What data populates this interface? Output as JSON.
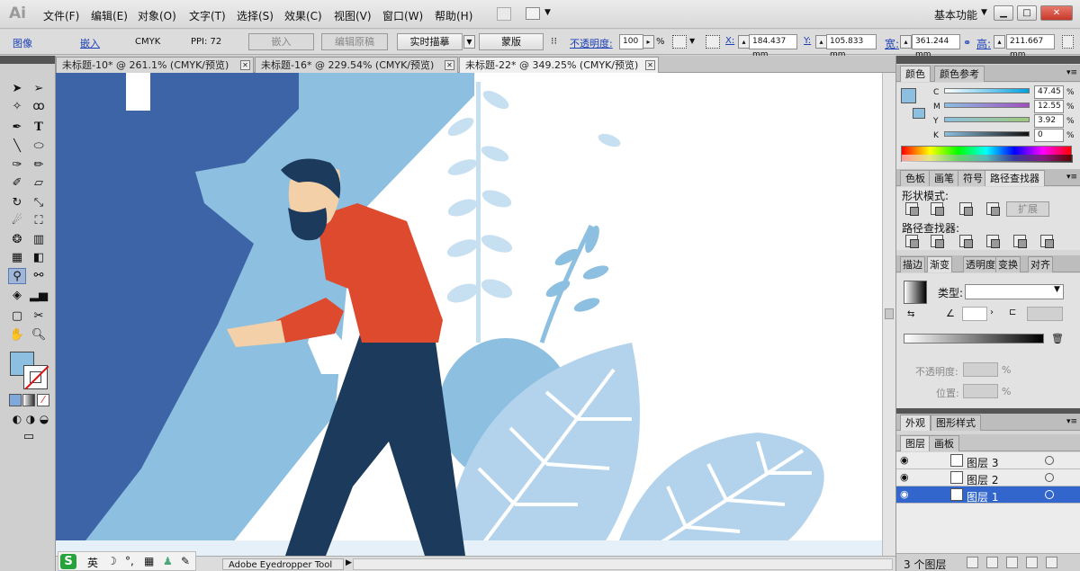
{
  "app": {
    "logo": "Ai"
  },
  "menu": [
    "文件(F)",
    "编辑(E)",
    "对象(O)",
    "文字(T)",
    "选择(S)",
    "效果(C)",
    "视图(V)",
    "窗口(W)",
    "帮助(H)"
  ],
  "workspace": {
    "label": "基本功能",
    "caret": "▼"
  },
  "window_controls": {
    "minimize": "▁",
    "restore": "□",
    "close": "✕"
  },
  "controlbar": {
    "image_label": "图像",
    "embed_link": "嵌入",
    "colormode": "CMYK",
    "ppi": "PPI: 72",
    "embed_button": "嵌入",
    "edit_original": "编辑原稿",
    "live_trace": "实时描摹",
    "mask": "蒙版",
    "opacity_label": "不透明度:",
    "opacity_value": "100",
    "pct": "%",
    "x_label": "X:",
    "x_value": "184.437 mm",
    "y_label": "Y:",
    "y_value": "105.833 mm",
    "w_label": "宽:",
    "w_value": "361.244 mm",
    "h_label": "高:",
    "h_value": "211.667 mm"
  },
  "tabs": [
    {
      "label": "未标题-10* @ 261.1% (CMYK/预览)",
      "active": false
    },
    {
      "label": "未标题-16* @ 229.54% (CMYK/预览)",
      "active": false
    },
    {
      "label": "未标题-22* @ 349.25% (CMYK/预览)",
      "active": true
    }
  ],
  "tools": [
    "selection-tool",
    "direct-selection-tool",
    "magic-wand-tool",
    "lasso-tool",
    "pen-tool",
    "type-tool",
    "line-tool",
    "ellipse-tool",
    "paintbrush-tool",
    "pencil-tool",
    "blob-brush-tool",
    "eraser-tool",
    "rotate-tool",
    "scale-tool",
    "warp-tool",
    "free-transform-tool",
    "symbol-sprayer-tool",
    "column-graph-tool",
    "mesh-tool",
    "gradient-tool",
    "eyedropper-tool",
    "blend-tool",
    "live-paint-tool",
    "slice-tool",
    "artboard-tool",
    "scissors-tool",
    "hand-tool",
    "zoom-tool"
  ],
  "colors": {
    "fill": "#8cbfe0",
    "accent_blue": "#3266cc",
    "shirt": "#dd4a2d",
    "trousers": "#1c3b5c",
    "dark_blue": "#3d64a6"
  },
  "color_panel": {
    "tabs": [
      "颜色",
      "颜色参考"
    ],
    "channels": [
      {
        "label": "C",
        "value": "47.45",
        "pct": "%"
      },
      {
        "label": "M",
        "value": "12.55",
        "pct": "%"
      },
      {
        "label": "Y",
        "value": "3.92",
        "pct": "%"
      },
      {
        "label": "K",
        "value": "0",
        "pct": "%"
      }
    ]
  },
  "pathfinder_panel": {
    "tabs": [
      "色板",
      "画笔",
      "符号",
      "路径查找器"
    ],
    "shape_modes": "形状模式:",
    "pathfinders": "路径查找器:",
    "expand": "扩展"
  },
  "gradient_panel": {
    "tabs": [
      "描边",
      "渐变",
      "透明度",
      "变换",
      "对齐"
    ],
    "type_label": "类型:",
    "opacity_label": "不透明度:",
    "location_label": "位置:",
    "pct": "%"
  },
  "appearance_panel": {
    "tabs": [
      "外观",
      "图形样式"
    ]
  },
  "layers_panel": {
    "tabs": [
      "图层",
      "画板"
    ],
    "layers": [
      {
        "name": "图层 3",
        "selected": false
      },
      {
        "name": "图层 2",
        "selected": false
      },
      {
        "name": "图层 1",
        "selected": true
      }
    ],
    "count": "3 个图层"
  },
  "status": {
    "tool": "Adobe Eyedropper Tool",
    "arrow": "▶"
  },
  "ime": {
    "logo": "S",
    "lang": "英",
    "moon": "☽",
    "dot": "°,",
    "keyboard": "▦",
    "person": "♟",
    "tool": "✎"
  }
}
